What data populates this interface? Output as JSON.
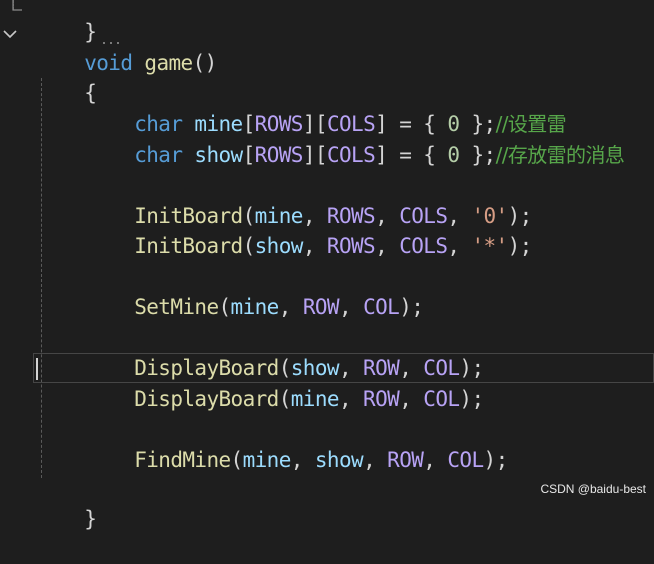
{
  "editor": {
    "lines": {
      "prev_close": "}",
      "signature": {
        "ret": "void",
        "name": "game",
        "parens": "()"
      },
      "open_brace": "{",
      "mine_decl": {
        "type": "char",
        "name": "mine",
        "a": "[",
        "rows": "ROWS",
        "b": "][",
        "cols": "COLS",
        "c": "] = { ",
        "zero": "0",
        "d": " };",
        "comment": "//设置雷"
      },
      "show_decl": {
        "type": "char",
        "name": "show",
        "a": "[",
        "rows": "ROWS",
        "b": "][",
        "cols": "COLS",
        "c": "] = { ",
        "zero": "0",
        "d": " };",
        "comment": "//存放雷的消息"
      },
      "init_mine": {
        "fn": "InitBoard",
        "p1": "(",
        "arg1": "mine",
        "s1": ", ",
        "arg2": "ROWS",
        "s2": ", ",
        "arg3": "COLS",
        "s3": ", ",
        "lit": "'0'",
        "end": ");"
      },
      "init_show": {
        "fn": "InitBoard",
        "p1": "(",
        "arg1": "show",
        "s1": ", ",
        "arg2": "ROWS",
        "s2": ", ",
        "arg3": "COLS",
        "s3": ", ",
        "lit": "'*'",
        "end": ");"
      },
      "setmine": {
        "fn": "SetMine",
        "p1": "(",
        "arg1": "mine",
        "s1": ", ",
        "arg2": "ROW",
        "s2": ", ",
        "arg3": "COL",
        "end": ");"
      },
      "display_show": {
        "fn": "DisplayBoard",
        "p1": "(",
        "arg1": "show",
        "s1": ", ",
        "arg2": "ROW",
        "s2": ", ",
        "arg3": "COL",
        "end": ");"
      },
      "display_mine": {
        "fn": "DisplayBoard",
        "p1": "(",
        "arg1": "mine",
        "s1": ", ",
        "arg2": "ROW",
        "s2": ", ",
        "arg3": "COL",
        "end": ");"
      },
      "findmine": {
        "fn": "FindMine",
        "p1": "(",
        "arg1": "mine",
        "s1": ", ",
        "arg2": "show",
        "s2": ", ",
        "arg3": "ROW",
        "s3": ", ",
        "arg4": "COL",
        "end": ");"
      },
      "close_brace": "}"
    },
    "fold_icon": "chevron-down-icon"
  },
  "watermark": "CSDN @baidu-best",
  "colors": {
    "background": "#1e1e1e",
    "keyword": "#569cd6",
    "function": "#dcdcaa",
    "variable": "#9cdcfe",
    "macro": "#b8a3f5",
    "number": "#b5cea8",
    "string": "#d69d85",
    "comment": "#57a64a"
  }
}
